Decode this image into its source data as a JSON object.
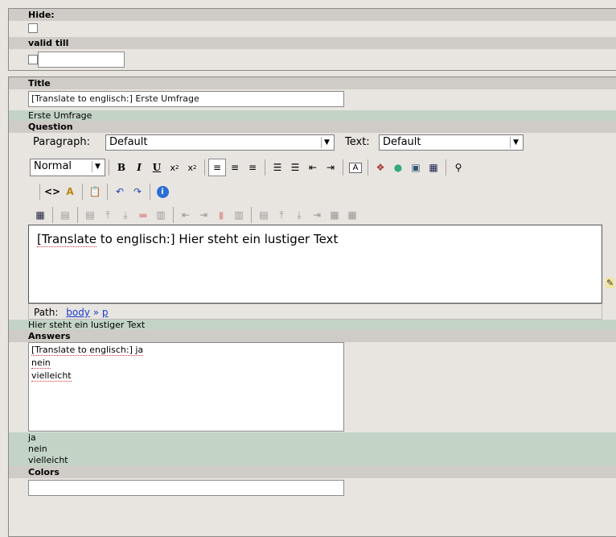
{
  "top": {
    "hide_label": "Hide:",
    "valid_label": "valid till",
    "valid_value": ""
  },
  "form": {
    "title_label": "Title",
    "title_value": "[Translate to englisch:] Erste Umfrage",
    "title_orig": "Erste Umfrage",
    "question_label": "Question",
    "answers_label": "Answers",
    "answers_value": [
      "[Translate to englisch:] ja",
      "nein",
      "vielleicht"
    ],
    "answers_orig": [
      "ja",
      "nein",
      "vielleicht"
    ],
    "colors_label": "Colors"
  },
  "rte": {
    "paragraph_label": "Paragraph:",
    "paragraph_value": "Default",
    "text_label": "Text:",
    "text_value": "Default",
    "style_value": "Normal",
    "content_prefix": "[Translate",
    "content_rest": " to englisch:] Hier steht ein lustiger Text",
    "path_label": "Path:",
    "path_body": "body",
    "path_sep": "»",
    "path_p": "p",
    "orig_text": "Hier steht ein lustiger Text",
    "icons_row1": [
      "bold-icon",
      "italic-icon",
      "underline-icon",
      "subscript-icon",
      "superscript-icon",
      "align-left-icon",
      "align-center-icon",
      "align-right-icon",
      "ordered-list-icon",
      "unordered-list-icon",
      "outdent-icon",
      "indent-icon",
      "text-color-icon",
      "insert-object-icon",
      "insert-link-icon",
      "insert-image-icon",
      "insert-table-icon",
      "find-icon"
    ],
    "icons_row2": [
      "view-source-icon",
      "spellcheck-icon",
      "paste-icon",
      "undo-icon",
      "redo-icon",
      "about-icon"
    ]
  }
}
